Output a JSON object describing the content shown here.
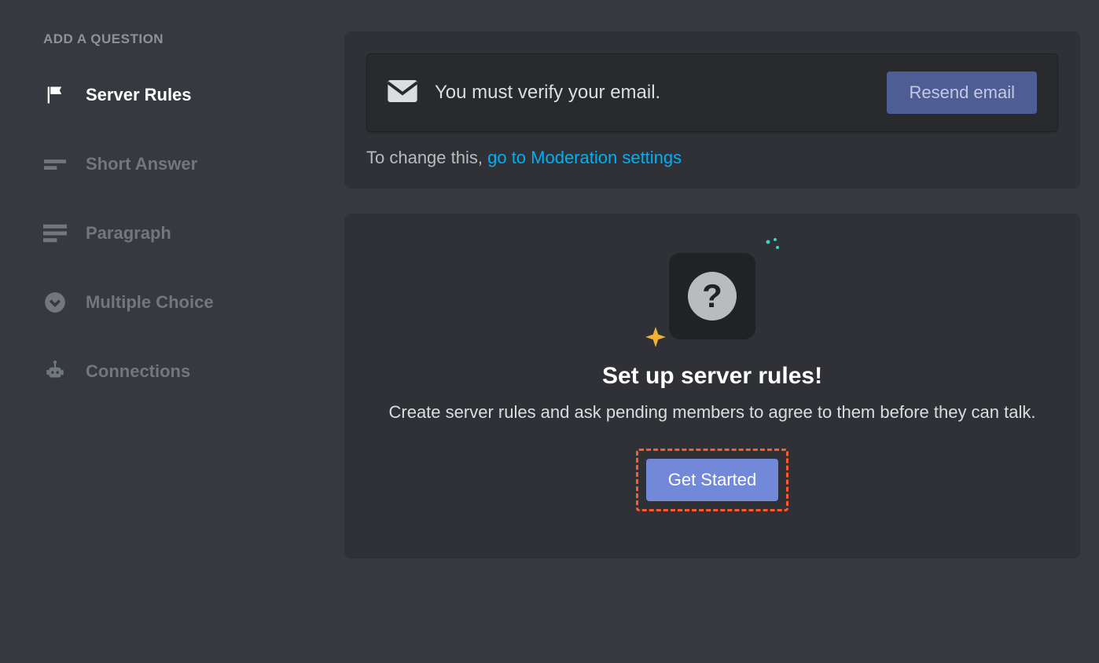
{
  "sidebar": {
    "heading": "ADD A QUESTION",
    "items": [
      {
        "label": "Server Rules",
        "icon": "flag"
      },
      {
        "label": "Short Answer",
        "icon": "short-text"
      },
      {
        "label": "Paragraph",
        "icon": "paragraph"
      },
      {
        "label": "Multiple Choice",
        "icon": "chevron-circle"
      },
      {
        "label": "Connections",
        "icon": "robot"
      }
    ]
  },
  "verify": {
    "message": "You must verify your email.",
    "button": "Resend email",
    "change_prefix": "To change this, ",
    "change_link": "go to Moderation settings"
  },
  "setup": {
    "title": "Set up server rules!",
    "description": "Create server rules and ask pending members to agree to them before they can talk.",
    "button": "Get Started"
  }
}
